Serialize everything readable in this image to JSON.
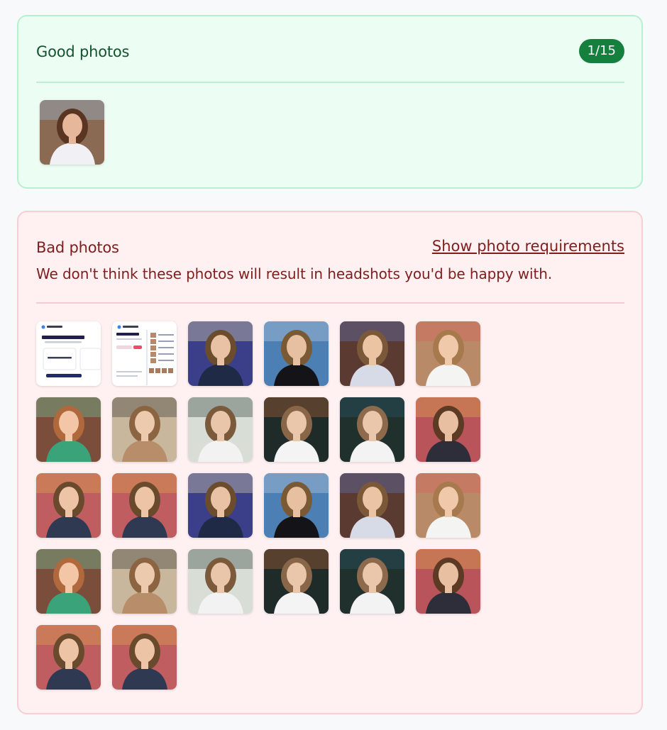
{
  "good": {
    "title": "Good photos",
    "count": "1/15",
    "photos": [
      "green-leis-portrait"
    ]
  },
  "bad": {
    "title": "Bad photos",
    "requirements_link": "Show photo requirements",
    "description": "We don't think these photos will result in headshots you'd be happy with.",
    "photos": [
      "screenshot-app",
      "screenshot-list",
      "friends-lights",
      "dark-shirt-car",
      "striped-top",
      "white-blouse-market",
      "green-jacket",
      "mirror-selfie",
      "cafe-desk",
      "bookshelf-dark",
      "bookshelf-sitting",
      "red-wall-standing",
      "red-wall-striped",
      "red-wall-striped",
      "friends-lights",
      "dark-shirt-car",
      "striped-top",
      "white-blouse-market",
      "green-jacket",
      "mirror-selfie",
      "cafe-desk",
      "bookshelf-dark",
      "bookshelf-sitting",
      "red-wall-standing",
      "red-wall-striped",
      "red-wall-striped"
    ]
  },
  "colors": {
    "good_bg": "#ecfdf3",
    "good_text": "#14532d",
    "badge_bg": "#15803d",
    "bad_bg": "#fff1f2",
    "bad_text": "#7f1d1d"
  }
}
